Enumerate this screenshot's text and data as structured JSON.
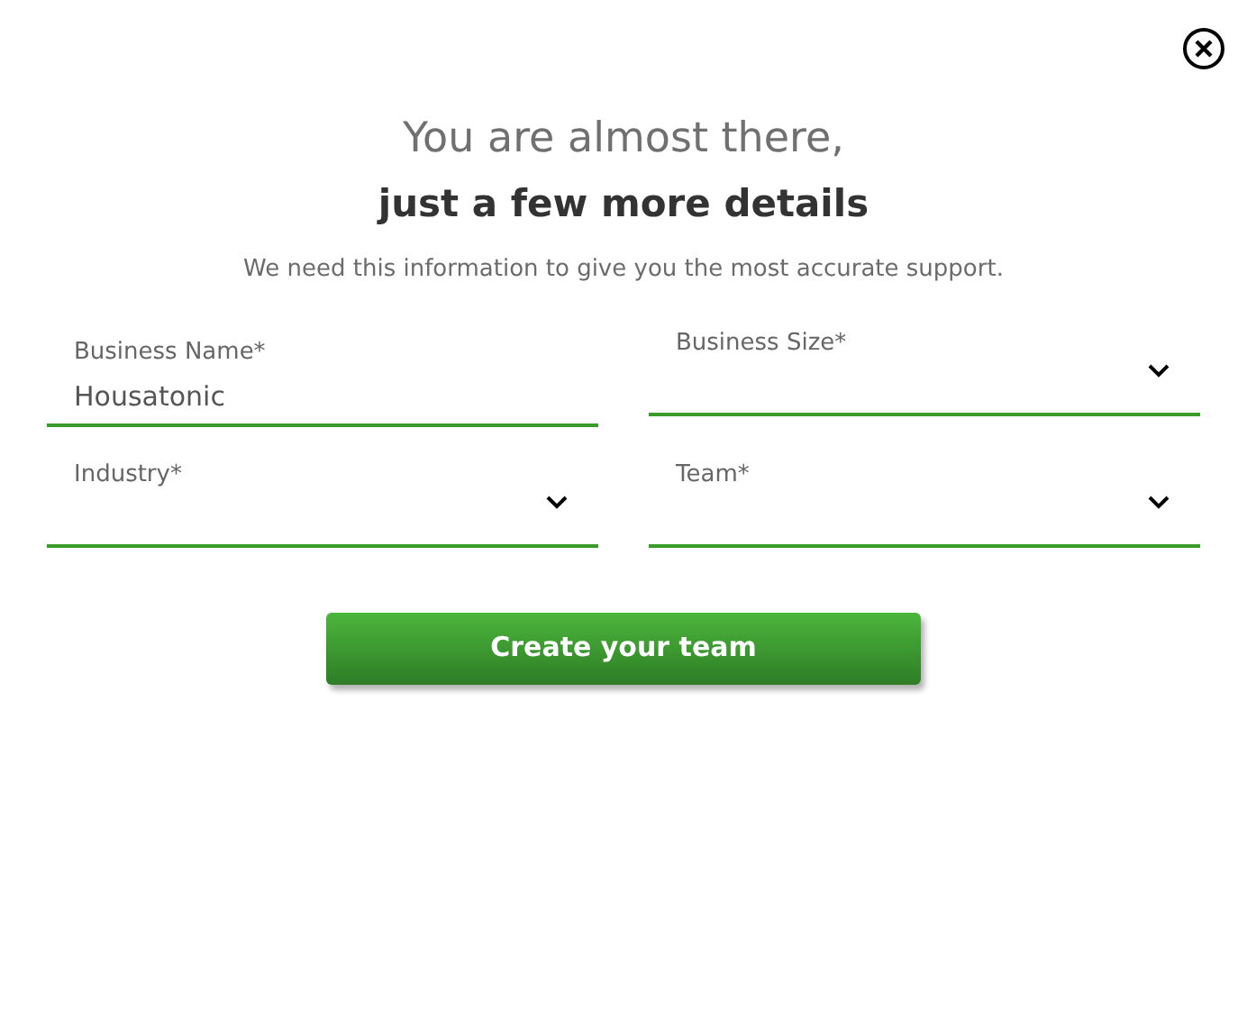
{
  "heading": "You are almost there,",
  "subheading": "just a few more details",
  "description": "We need this information to give you the most accurate support.",
  "fields": [
    {
      "kind": "text",
      "label": "Business Name*",
      "value": "Housatonic"
    },
    {
      "kind": "select",
      "label": "Business Size*"
    },
    {
      "kind": "select",
      "label": "Industry*"
    },
    {
      "kind": "select",
      "label": "Team*"
    }
  ],
  "submit_button": "Create your team"
}
